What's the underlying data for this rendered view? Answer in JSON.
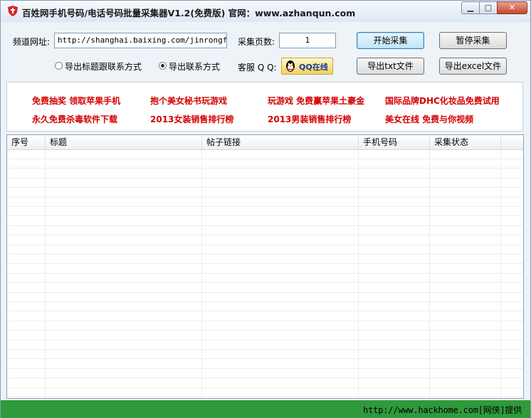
{
  "window": {
    "title": "百姓网手机号码/电话号码批量采集器V1.2(免费版)   官网：www.azhanqun.com",
    "minimize_glyph": "▁",
    "maximize_glyph": "□",
    "close_glyph": "✕"
  },
  "form": {
    "channel_url_label": "频道网址:",
    "channel_url_value": "http://shanghai.baixing.com/jinrongfuwu/",
    "pages_label": "采集页数:",
    "pages_value": "1",
    "start_button": "开始采集",
    "pause_button": "暂停采集",
    "export_txt_button": "导出txt文件",
    "export_excel_button": "导出excel文件",
    "radio_title_contact": "导出标题跟联系方式",
    "radio_contact_only": "导出联系方式",
    "radio_selected": "contact_only",
    "support_label": "客服 Q Q:",
    "qq_online_label": "QQ在线"
  },
  "ads": [
    [
      "免费抽奖 领取苹果手机",
      "抱个美女秘书玩游戏",
      "玩游戏 免费赢苹果土豪金",
      "国际品牌DHC化妆品免费试用"
    ],
    [
      "永久免费杀毒软件下载",
      "2013女装销售排行榜",
      "2013男装销售排行榜",
      "美女在线 免费与你视频"
    ]
  ],
  "table": {
    "columns": [
      "序号",
      "标题",
      "帖子链接",
      "手机号码",
      "采集状态"
    ]
  },
  "statusbar": {
    "text": "http://www.hackhome.com[网侠]提供"
  },
  "colors": {
    "ad_text": "#d40000",
    "statusbar": "#2f9a3c",
    "qq_button": "#f2d35c"
  }
}
